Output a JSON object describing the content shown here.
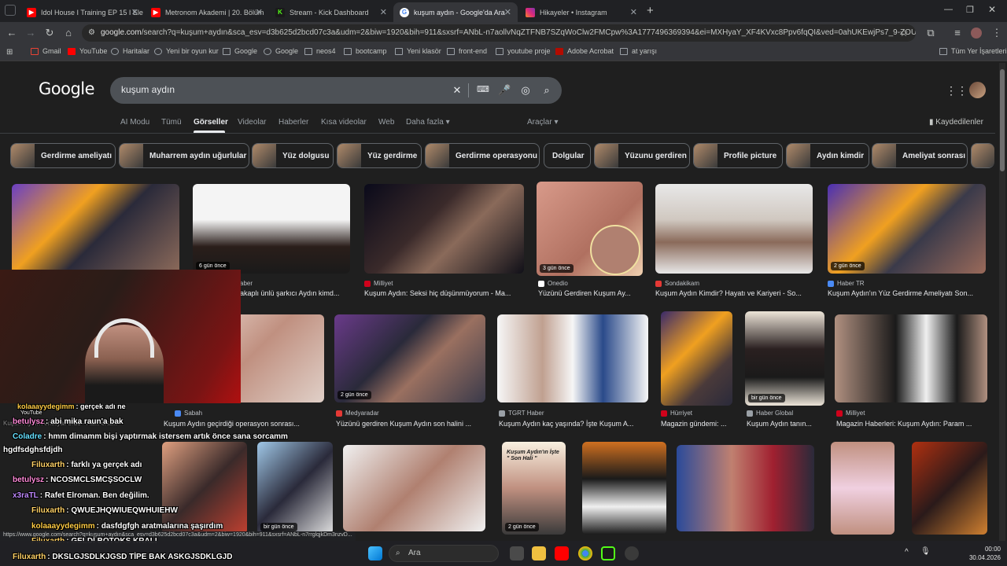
{
  "browser": {
    "tabs": [
      {
        "title": "Idol House I Training EP 15 I Ele",
        "favicon_color": "#ff0000"
      },
      {
        "title": "Metronom Akademi | 20. Bölüm",
        "favicon_color": "#ff0000"
      },
      {
        "title": "Stream - Kick Dashboard",
        "favicon_color": "#53fc18"
      },
      {
        "title": "kuşum aydın - Google'da Ara",
        "favicon_color": "#4285f4"
      },
      {
        "title": "Hikayeler • Instagram",
        "favicon_color": "#e1306c"
      }
    ],
    "new_tab": "+",
    "address": {
      "host": "google.com",
      "path": "/search?q=kuşum+aydın&sca_esv=d3b625d2bcd07c3a&udm=2&biw=1920&bih=911&sxsrf=ANbL-n7aollvNqZTFNB7SZqWoClw2FMCpw%3A1777496369394&ei=MXHyaY_XF4KVxc8Ppv6fqQI&ved=0ahUKEwjPs7_9-ZOUAxWCSvE..."
    },
    "bookmarks": [
      "Gmail",
      "YouTube",
      "Haritalar",
      "Yeni bir oyun kur",
      "Google",
      "Google",
      "neos4",
      "bootcamp",
      "Yeni klasör",
      "front-end",
      "youtube proje",
      "Adobe Acrobat",
      "at yarışı"
    ],
    "all_bookmarks": "Tüm Yer İşaretleri"
  },
  "google": {
    "logo": "Google",
    "query": "kuşum aydın",
    "tabs": [
      "AI Modu",
      "Tümü",
      "Görseller",
      "Videolar",
      "Haberler",
      "Kısa videolar",
      "Web",
      "Daha fazla"
    ],
    "tools": "Araçlar",
    "saved": "Kaydedilenler",
    "chips": [
      "Gerdirme ameliyatı",
      "Muharrem aydın uğurlular",
      "Yüz dolgusu",
      "Yüz gerdirme",
      "Gerdirme operasyonu",
      "Dolgular",
      "Yüzunu gerdiren",
      "Profile picture",
      "Aydın kimdir",
      "Ameliyat sonrası"
    ],
    "results_row1": [
      {
        "source": "",
        "caption": "",
        "badge": ""
      },
      {
        "source": "aber",
        "caption": "akaplı ünlü şarkıcı Aydın kimd...",
        "badge": "6 gün önce"
      },
      {
        "source": "Milliyet",
        "caption": "Kuşum Aydın: Seksi hiç düşünmüyorum - Ma...",
        "badge": ""
      },
      {
        "source": "Onedio",
        "caption": "Yüzünü Gerdiren Kuşum Ay...",
        "badge": "3 gün önce"
      },
      {
        "source": "Sondakikam",
        "caption": "Kuşum Aydın Kimdir? Hayatı ve Kariyeri - So...",
        "badge": ""
      },
      {
        "source": "Haber TR",
        "caption": "Kuşum Aydın'ın Yüz Gerdirme Ameliyatı Son...",
        "badge": "2 gün önce"
      }
    ],
    "results_row2": [
      {
        "source": "Sabah",
        "caption": "Kuşum Aydın geçirdiği operasyon sonrası...",
        "badge": ""
      },
      {
        "source": "Medyaradar",
        "caption": "Yüzünü gerdiren Kuşum Aydın son halini ...",
        "badge": "2 gün önce"
      },
      {
        "source": "TGRT Haber",
        "caption": "Kuşum Aydın kaç yaşında? İşte Kuşum A...",
        "badge": ""
      },
      {
        "source": "Hürriyet",
        "caption": "Magazin gündemi: ...",
        "badge": ""
      },
      {
        "source": "Haber Global",
        "caption": "Kuşum Aydın tanın...",
        "badge": "bir gün önce"
      },
      {
        "source": "Milliyet",
        "caption": "Magazin Haberleri: Kuşum Aydın: Param ...",
        "badge": ""
      }
    ],
    "row3_badges": [
      "bir gün önce",
      "2 gün önce"
    ],
    "row3_overlay_text": "Kuşum Aydın'ın İşte \" Son Hali \""
  },
  "stream_chat": [
    {
      "user": "kolaaayydegimm",
      "text": ": gerçek adı ne"
    },
    {
      "user": "betulysz",
      "text": ": abi mika raun'a bak"
    },
    {
      "user": "Coladre",
      "text": ": hmm dimamm bişi yaptırmak istersem artık önce sana sorcamm"
    },
    {
      "user": "hgdfsdghsfdjdh",
      "text": ""
    },
    {
      "user": "Filuxarth",
      "text": ": farklı ya gerçek adı"
    },
    {
      "user": "betulysz",
      "text": ": NCOSMCLSMCŞSOCLW"
    },
    {
      "user": "x3raTL",
      "text": ": Rafet Elroman. Ben değilim."
    },
    {
      "user": "Filuxarth",
      "text": ": QWUEJHQWIUEQWHUIEHW"
    },
    {
      "user": "kolaaayydegimm",
      "text": ": dasfdgfgh aratmalarına şaşırdım"
    },
    {
      "user": "Filuxarth",
      "text": ": GELDİ BOTOKS KRALI"
    },
    {
      "user": "Filuxarth",
      "text": ": DKSLGJSDLKJGSD TİPE BAK ASKGJSDKLGJD"
    }
  ],
  "chat_partial": {
    "youtube_label": "YouTube",
    "faint_line": "Kuşum Aydın Ameliyat Oldu - Ha... orta..."
  },
  "status_url": "https://www.google.com/search?q=kuşum+aydın&sca_esv=d3b625d2bcd07c3a&udm=2&biw=1920&bih=911&sxsrf=ANbL-n7rrglqjkDm3nzvD...",
  "taskbar": {
    "search_placeholder": "Ara",
    "time": "00:00",
    "date": "30.04.2026"
  }
}
